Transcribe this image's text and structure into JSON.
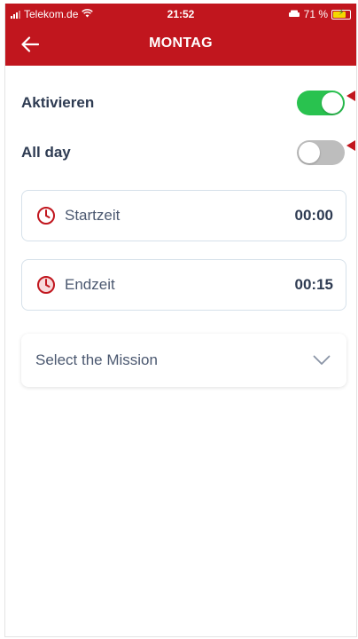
{
  "status_bar": {
    "carrier": "Telekom.de",
    "time": "21:52",
    "battery": "71 %"
  },
  "header": {
    "title": "MONTAG",
    "back_icon": "arrow-left-icon"
  },
  "settings": {
    "activate": {
      "label": "Aktivieren",
      "enabled": true
    },
    "all_day": {
      "label": "All day",
      "enabled": false
    }
  },
  "times": {
    "start": {
      "label": "Startzeit",
      "value": "00:00",
      "icon": "clock-icon"
    },
    "end": {
      "label": "Endzeit",
      "value": "00:15",
      "icon": "clock-icon"
    }
  },
  "mission": {
    "placeholder": "Select the Mission",
    "icon": "chevron-down-icon"
  },
  "colors": {
    "brand": "#c1161e",
    "toggle_on": "#29c24f",
    "toggle_off": "#bdbdbd",
    "text_dark": "#2e3b52"
  }
}
